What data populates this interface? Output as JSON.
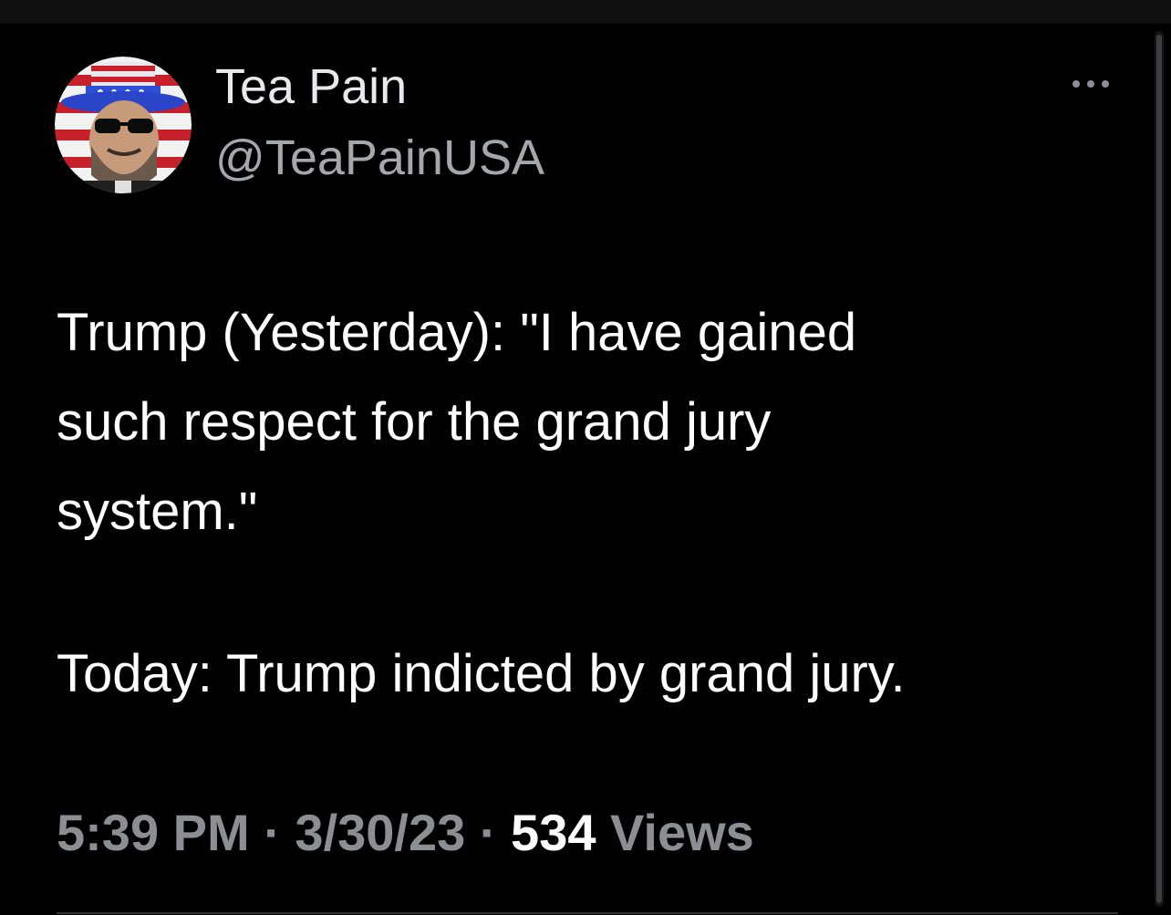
{
  "tweet": {
    "author": {
      "display_name": "Tea Pain",
      "handle": "@TeaPainUSA",
      "avatar_icon": "avatar-uncle-sam-hat-icon"
    },
    "more_icon": "more-horizontal-icon",
    "body_lines": [
      "Trump (Yesterday): \"I have gained",
      "such respect for the grand jury",
      "system.\"",
      "Today: Trump indicted by grand jury."
    ],
    "meta": {
      "time": "5:39 PM",
      "separator": "·",
      "date": "3/30/23",
      "views_count": "534",
      "views_label": "Views"
    }
  },
  "colors": {
    "background": "#000000",
    "primary_text": "#e7e9ea",
    "secondary_text": "#8b8f94",
    "divider": "#2f3336"
  }
}
